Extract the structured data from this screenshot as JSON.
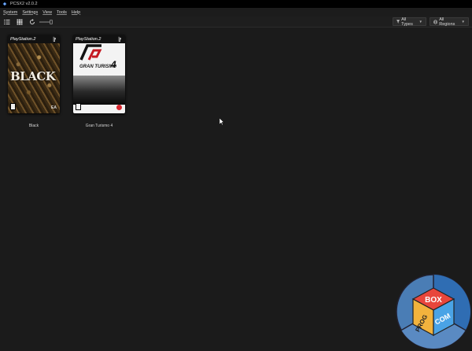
{
  "window": {
    "title": "PCSX2 v2.0.2"
  },
  "menu": {
    "items": [
      {
        "label": "System"
      },
      {
        "label": "Settings"
      },
      {
        "label": "View"
      },
      {
        "label": "Tools"
      },
      {
        "label": "Help"
      }
    ]
  },
  "toolbar": {
    "icons": [
      "list-view-icon",
      "grid-view-icon",
      "refresh-icon",
      "cover-scale-slider"
    ],
    "filter_types": {
      "icon": "funnel-icon",
      "label": "All Types"
    },
    "filter_regions": {
      "icon": "globe-icon",
      "label": "All Regions"
    }
  },
  "games": [
    {
      "title": "Black",
      "cover_brand": "PlayStation.2",
      "cover_logo": "BLACK",
      "publisher_mark": "EA"
    },
    {
      "title": "Gran Turismo 4",
      "cover_brand": "PlayStation.2",
      "cover_logo": "GRAN TURISMO",
      "cover_number": "4"
    }
  ],
  "watermark": {
    "line1": "BOX",
    "line2": "PROG",
    "line3": "COM"
  },
  "colors": {
    "background": "#1b1b1b",
    "titlebar": "#000000",
    "text": "#e0e0e0",
    "watermark_blue": "#3a7fd0",
    "watermark_orange": "#f0a33a",
    "watermark_red": "#d8323a"
  }
}
